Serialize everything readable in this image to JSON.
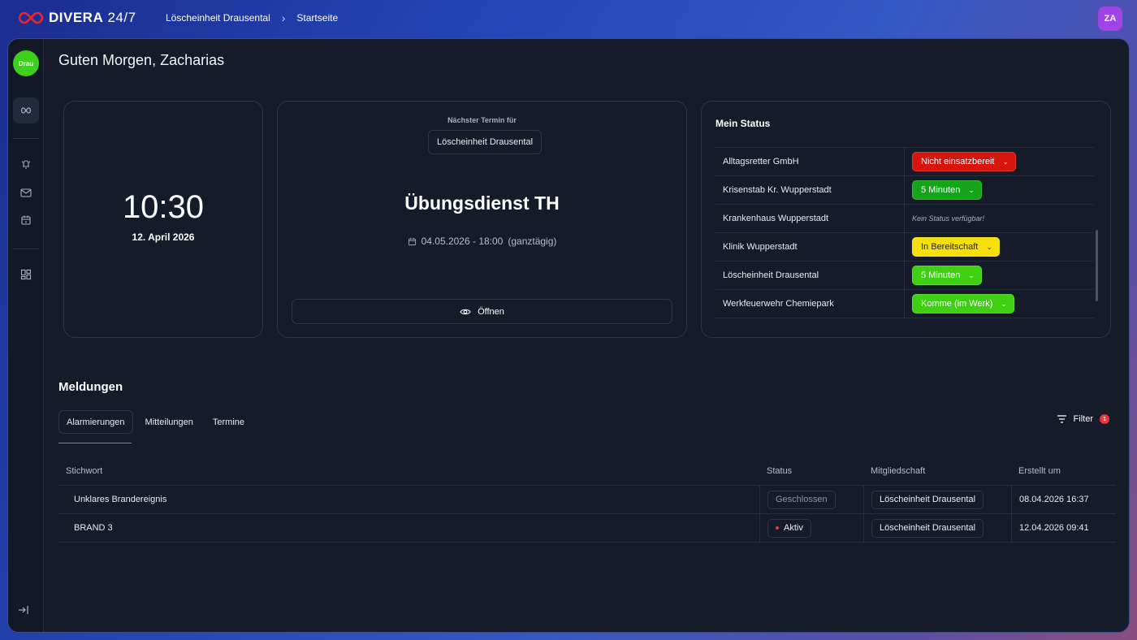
{
  "app": {
    "logo_brand": "DIVERA",
    "logo_suffix": " 24/7",
    "user_initials": "ZA"
  },
  "breadcrumb": {
    "unit": "Löscheinheit Drausental",
    "page": "Startseite"
  },
  "sidebar": {
    "org_badge": "Drau",
    "items": [
      {
        "icon": "infinity-icon",
        "active": true
      },
      {
        "icon": "alarm-bell-icon"
      },
      {
        "icon": "mail-icon"
      },
      {
        "icon": "calendar-icon"
      },
      {
        "icon": "dashboard-grid-icon"
      }
    ],
    "collapse_icon": "collapse-sidebar-icon"
  },
  "greeting": "Guten Morgen, Zacharias",
  "clock": {
    "time": "10:30",
    "date": "12. April 2026"
  },
  "next_event": {
    "label": "Nächster Termin für",
    "unit": "Löscheinheit Drausental",
    "title": "Übungsdienst TH",
    "datetime": "04.05.2026 - 18:00",
    "allday": "(ganztägig)",
    "open_label": "Öffnen"
  },
  "my_status": {
    "title": "Mein Status",
    "rows": [
      {
        "org": "Alltagsretter GmbH",
        "status": "Nicht einsatzbereit",
        "color": "#d8140f",
        "text_color": "#ffffff"
      },
      {
        "org": "Krisenstab Kr. Wupperstadt",
        "status": "5 Minuten",
        "color": "#15a51a",
        "text_color": "#ffffff"
      },
      {
        "org": "Krankenhaus Wupperstadt",
        "status": null,
        "empty_text": "Kein Status verfügbar!"
      },
      {
        "org": "Klinik Wupperstadt",
        "status": "In Bereitschaft",
        "color": "#f5e00a",
        "text_color": "#1a1a1a"
      },
      {
        "org": "Löscheinheit Drausental",
        "status": "5 Minuten",
        "color": "#3fcf13",
        "text_color": "#ffffff"
      },
      {
        "org": "Werkfeuerwehr Chemiepark",
        "status": "Komme (im Werk)",
        "color": "#3fcf13",
        "text_color": "#ffffff"
      }
    ]
  },
  "messages": {
    "title": "Meldungen",
    "tabs": [
      "Alarmierungen",
      "Mitteilungen",
      "Termine"
    ],
    "active_tab": "Alarmierungen",
    "filter_label": "Filter",
    "filter_count": "1",
    "columns": [
      "Stichwort",
      "Status",
      "Mitgliedschaft",
      "Erstellt um"
    ],
    "rows": [
      {
        "keyword": "Unklares Brandereignis",
        "status": "Geschlossen",
        "active": false,
        "membership": "Löscheinheit Drausental",
        "created": "08.04.2026 16:37"
      },
      {
        "keyword": "BRAND 3",
        "status": "Aktiv",
        "active": true,
        "membership": "Löscheinheit Drausental",
        "created": "12.04.2026 09:41"
      }
    ]
  }
}
